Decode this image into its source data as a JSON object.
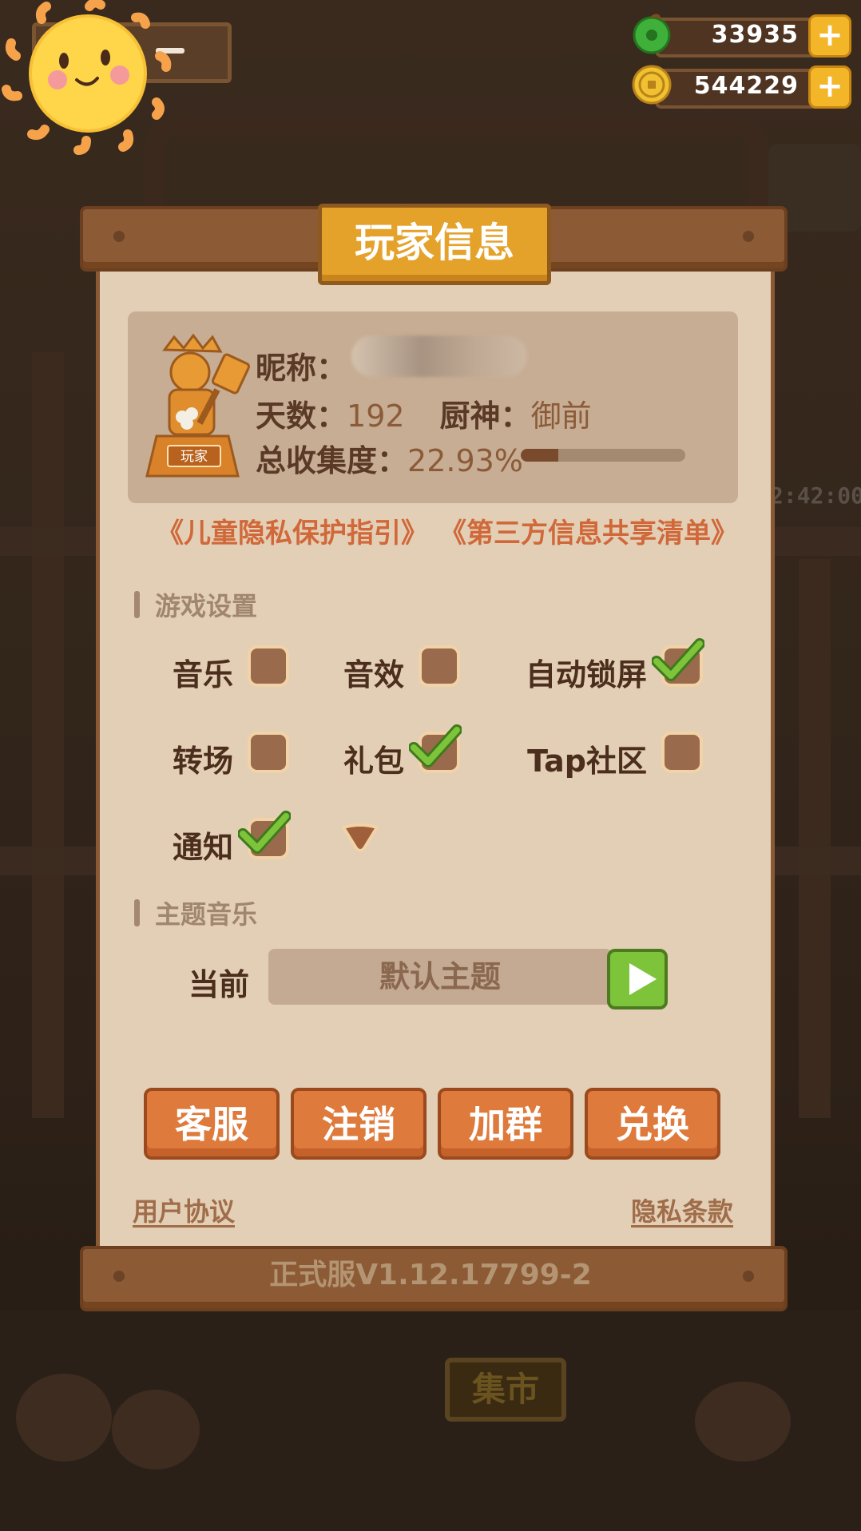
{
  "header": {
    "currencies": [
      {
        "name": "jade",
        "value": "33935",
        "icon": "jade-coin-icon",
        "color": "#3fb03a"
      },
      {
        "name": "gold",
        "value": "544229",
        "icon": "gold-coin-icon",
        "color": "#e8b52a"
      }
    ]
  },
  "dialog": {
    "title": "玩家信息",
    "profile": {
      "badge_label": "玩家",
      "nickname_label": "昵称：",
      "days_label": "天数：",
      "days_value": "192",
      "chef_god_label": "厨神：",
      "chef_god_value": "御前",
      "collection_label": "总收集度：",
      "collection_value": "22.93%",
      "collection_fraction": 0.2293
    },
    "links": {
      "child_privacy": "《儿童隐私保护指引》",
      "third_party": "《第三方信息共享清单》"
    },
    "settings": {
      "section_title": "游戏设置",
      "options": [
        {
          "label": "音乐",
          "checked": false
        },
        {
          "label": "音效",
          "checked": false
        },
        {
          "label": "自动锁屏",
          "checked": true
        },
        {
          "label": "转场",
          "checked": false
        },
        {
          "label": "礼包",
          "checked": true
        },
        {
          "label": "Tap社区",
          "checked": false
        },
        {
          "label": "通知",
          "checked": true
        }
      ]
    },
    "theme_music": {
      "section_title": "主题音乐",
      "current_label": "当前",
      "current_value": "默认主题"
    },
    "buttons": {
      "service": "客服",
      "logout": "注销",
      "join_group": "加群",
      "redeem": "兑换"
    },
    "footer": {
      "user_agreement": "用户协议",
      "privacy_terms": "隐私条款",
      "version": "正式服V1.12.17799-2"
    }
  },
  "background": {
    "market_sign": "集市",
    "timer": "2:42:00"
  }
}
